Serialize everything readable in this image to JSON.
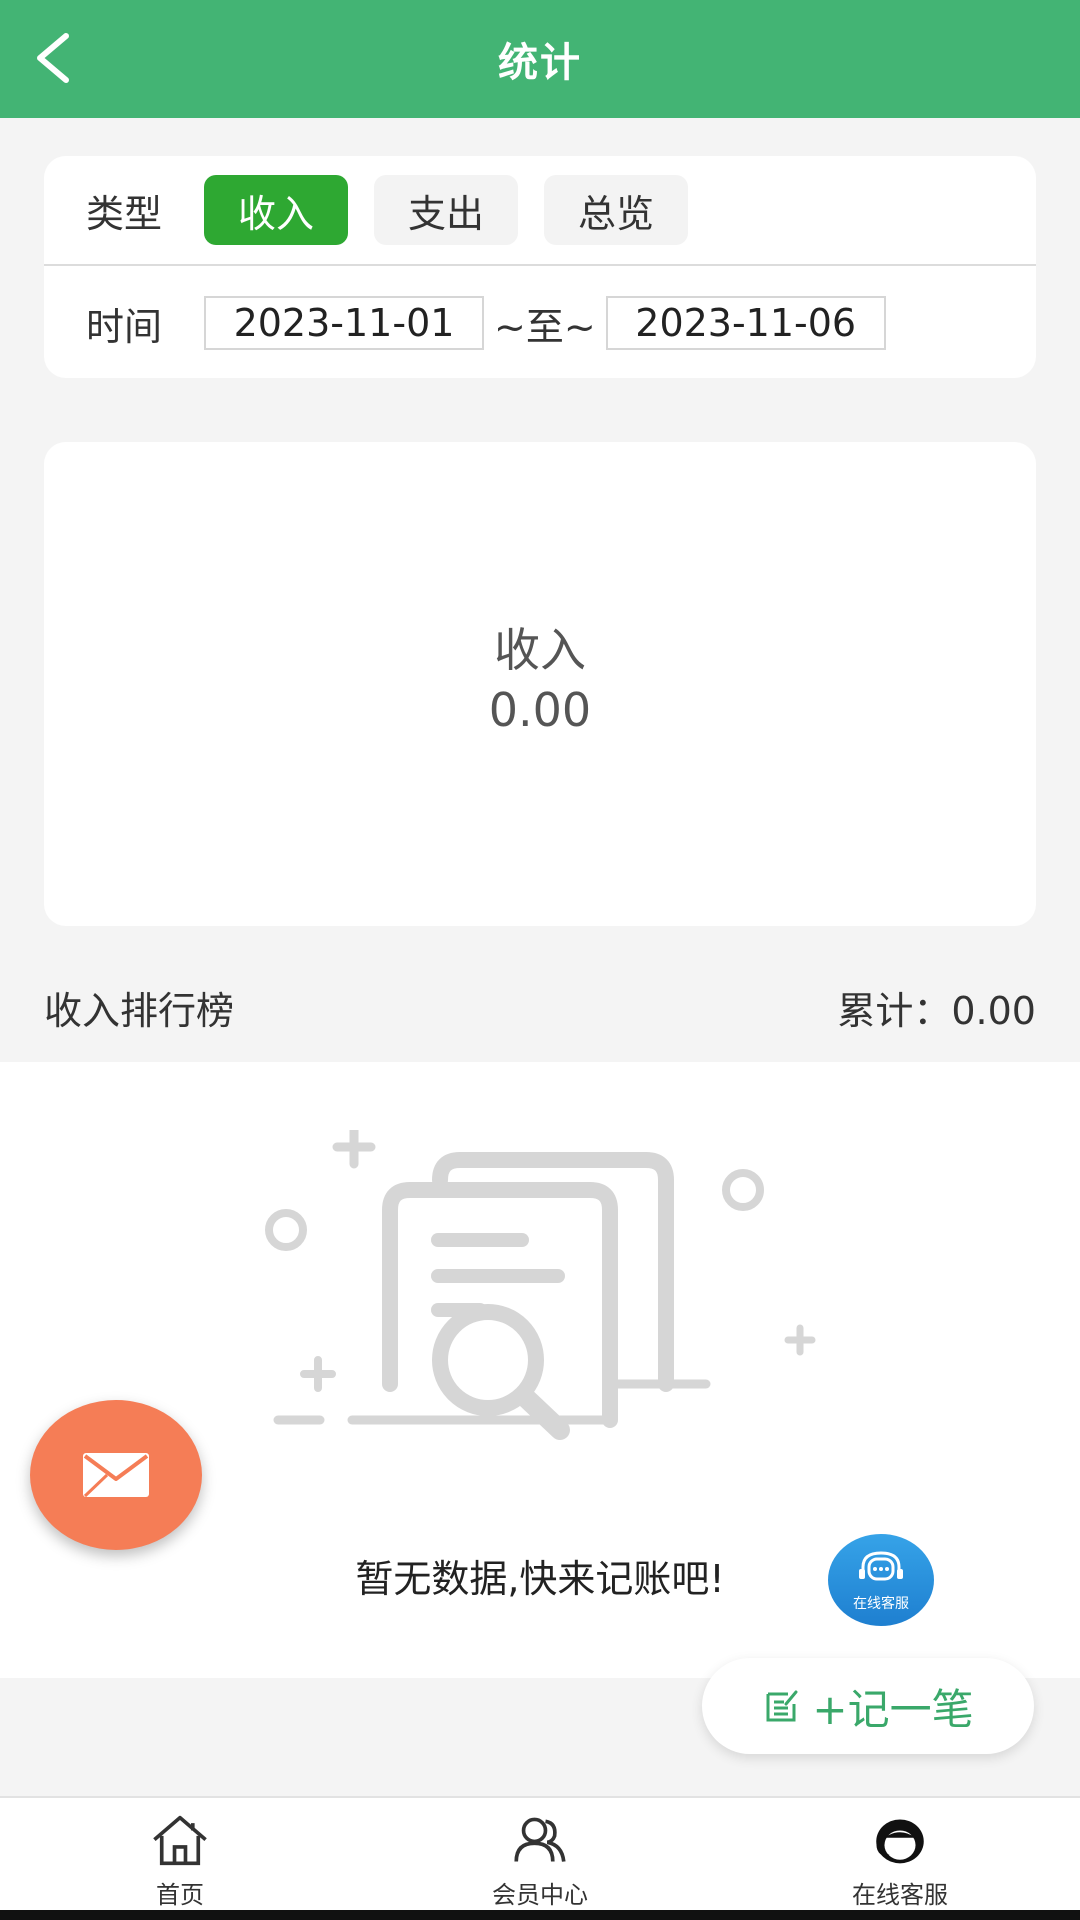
{
  "header": {
    "title": "统计"
  },
  "filter": {
    "type_label": "类型",
    "types": [
      "收入",
      "支出",
      "总览"
    ],
    "time_label": "时间",
    "start_date": "2023-11-01",
    "separator": "~至~",
    "end_date": "2023-11-06"
  },
  "summary": {
    "label": "收入",
    "amount": "0.00"
  },
  "ranking": {
    "title": "收入排行榜",
    "total": "累计：0.00"
  },
  "empty": {
    "message": "暂无数据,快来记账吧!"
  },
  "floating": {
    "service_label": "在线客服",
    "record_label": "+记一笔"
  },
  "tabbar": {
    "items": [
      {
        "label": "首页",
        "icon": "home-icon"
      },
      {
        "label": "会员中心",
        "icon": "users-icon"
      },
      {
        "label": "在线客服",
        "icon": "customer-service-icon"
      }
    ]
  },
  "colors": {
    "primary": "#43b474",
    "active": "#2ea832",
    "fab": "#f57d56"
  }
}
